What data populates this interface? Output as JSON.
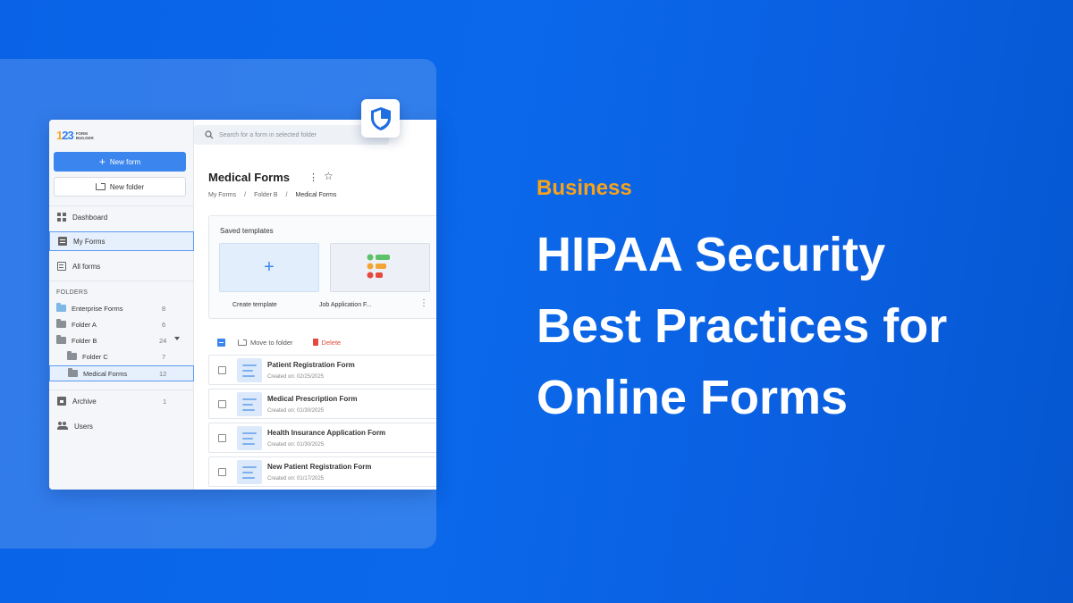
{
  "app": {
    "logo_number": "123",
    "logo_text_line1": "FORM",
    "logo_text_line2": "BUILDER",
    "search_placeholder": "Search for a form in selected folder"
  },
  "sidebar": {
    "new_form_label": "New form",
    "new_folder_label": "New folder",
    "nav": [
      {
        "label": "Dashboard",
        "icon": "dashboard-icon"
      },
      {
        "label": "My Forms",
        "icon": "forms-icon",
        "active": true
      },
      {
        "label": "All forms",
        "icon": "all-forms-icon"
      }
    ],
    "folders_title": "FOLDERS",
    "folders": [
      {
        "label": "Enterprise Forms",
        "count": "8"
      },
      {
        "label": "Folder A",
        "count": "6"
      },
      {
        "label": "Folder B",
        "count": "24"
      },
      {
        "label": "Folder C",
        "count": "7"
      },
      {
        "label": "Medical Forms",
        "count": "12",
        "active": true
      }
    ],
    "archive_label": "Archive",
    "archive_count": "1",
    "users_label": "Users"
  },
  "main": {
    "title": "Medical Forms",
    "breadcrumb": [
      "My Forms",
      "/",
      "Folder B",
      "/",
      "Medical Forms"
    ],
    "saved_templates_title": "Saved templates",
    "templates": [
      {
        "label": "Create template"
      },
      {
        "label": "Job Application F..."
      }
    ],
    "actions": {
      "move_label": "Move to folder",
      "delete_label": "Delete"
    },
    "forms": [
      {
        "name": "Patient Registration Form",
        "date": "Created on: 02/25/2025"
      },
      {
        "name": "Medical Prescription Form",
        "date": "Created on: 01/30/2025"
      },
      {
        "name": "Health Insurance Application Form",
        "date": "Created on: 01/30/2025"
      },
      {
        "name": "New Patient Registration Form",
        "date": "Created on: 01/17/2025"
      }
    ]
  },
  "hero": {
    "category": "Business",
    "headline_lines": [
      "HIPAA Security",
      "Best Practices for",
      "Online Forms"
    ]
  },
  "colors": {
    "background": "#0a63e6",
    "accent": "#f7a21b",
    "primary_button": "#3b86ee",
    "delete": "#e5483d"
  }
}
